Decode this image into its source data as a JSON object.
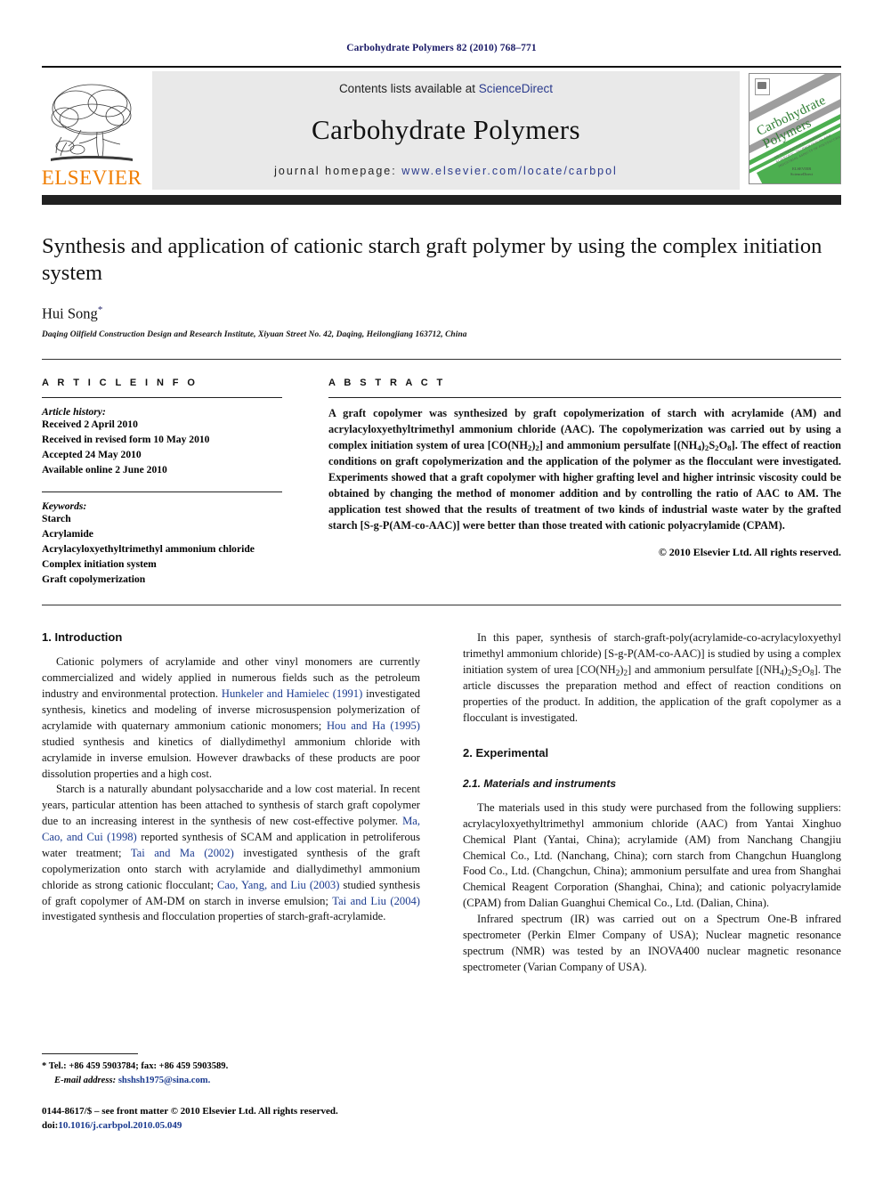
{
  "running_head": "Carbohydrate Polymers 82 (2010) 768–771",
  "masthead": {
    "publisher_name": "ELSEVIER",
    "contents_prefix": "Contents lists available at ",
    "contents_link": "ScienceDirect",
    "journal_title": "Carbohydrate Polymers",
    "homepage_prefix": "journal homepage: ",
    "homepage_url": "www.elsevier.com/locate/carbpol",
    "cover_title_line1": "Carbohydrate",
    "cover_title_line2": "Polymers",
    "cover_subtitle": "AN INTERNATIONAL JOURNAL OF SCIENTIFIC, TECHNOLOGICAL AND INDUSTRIAL ASPECTS OF POLYSACCHARIDES",
    "cover_footer_line1": "ELSEVIER",
    "cover_footer_line2": "ScienceDirect",
    "accent_orange": "#f07d00",
    "link_blue": "#2a3a8c",
    "band_gray": "#e9e9e9",
    "bar_dark": "#212121",
    "cover_green": "#4caf50"
  },
  "title": "Synthesis and application of cationic starch graft polymer by using the complex initiation system",
  "author": "Hui Song",
  "author_mark": "*",
  "affiliation": "Daqing Oilfield Construction Design and Research Institute, Xiyuan Street No. 42, Daqing, Heilongjiang 163712, China",
  "article_info": {
    "heading": "A R T I C L E   I N F O",
    "history_label": "Article history:",
    "history": [
      "Received 2 April 2010",
      "Received in revised form 10 May 2010",
      "Accepted 24 May 2010",
      "Available online 2 June 2010"
    ],
    "keywords_label": "Keywords:",
    "keywords": [
      "Starch",
      "Acrylamide",
      "Acrylacyloxyethyltrimethyl ammonium chloride",
      "Complex initiation system",
      "Graft copolymerization"
    ]
  },
  "abstract": {
    "heading": "A B S T R A C T",
    "copyright": "© 2010 Elsevier Ltd. All rights reserved."
  },
  "sections": {
    "introduction_heading": "1. Introduction",
    "experimental_heading": "2. Experimental",
    "materials_heading": "2.1. Materials and instruments"
  },
  "footnote": {
    "tel_line": "* Tel.: +86 459 5903784; fax: +86 459 5903589.",
    "email_label": "E-mail address:",
    "email": "shshsh1975@sina.com.",
    "issn_line": "0144-8617/$ – see front matter © 2010 Elsevier Ltd. All rights reserved.",
    "doi_label": "doi:",
    "doi": "10.1016/j.carbpol.2010.05.049"
  }
}
